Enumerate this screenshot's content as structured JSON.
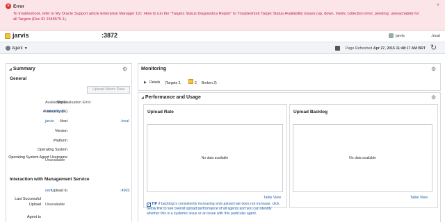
{
  "error": {
    "title": "Error",
    "message": "To troubleshoot, refer to My Oracle Support article Enterprise Manager 12c: How to run the \"Targets Status Diagnostics Report\" to Troubleshoot Target Status Availability Issues (up, down, metric collection error, pending, unreachable) for all Targets (Doc ID 1546575.1)."
  },
  "target": {
    "name": "jarvis",
    "port": ":3872",
    "user": "jarvis",
    "domain": ".local"
  },
  "toolbar": {
    "agent_menu": "Agent",
    "refreshed_label": "Page Refreshed",
    "refreshed_value": "Apr 27, 2015 11:48:17 AM BRT"
  },
  "summary": {
    "title": "Summary",
    "general_title": "General",
    "upload_button": "Upload Metric Data",
    "rows": [
      {
        "label": "Status",
        "value": "Availability Evaluation Error"
      },
      {
        "label": "Availability (%)",
        "value": "Unavailable"
      },
      {
        "label": "Host",
        "value": "jarvis",
        "extra": ".local"
      },
      {
        "label": "Version",
        "value": ""
      },
      {
        "label": "Platform",
        "value": ""
      },
      {
        "label": "Operating System",
        "value": ""
      },
      {
        "label": "Operating System Agent Username",
        "value": "Unavailable"
      }
    ],
    "interaction_title": "Interaction with Management Service",
    "interaction_rows": [
      {
        "label": "Upload to",
        "value": "oem",
        "extra": ":4903"
      },
      {
        "label": "Last Successful Upload",
        "value": "Unavailable"
      },
      {
        "label": "Agent to",
        "value": ""
      }
    ]
  },
  "monitoring": {
    "title": "Monitoring",
    "details_label": "Details",
    "targets_text": "(Targets 2,",
    "targets_count": "2,",
    "broken_text": "Broken 2)"
  },
  "performance": {
    "title": "Performance and Usage",
    "upload_rate_title": "Upload Rate",
    "upload_backlog_title": "Upload Backlog",
    "no_data": "No data available",
    "table_view": "Table View",
    "tip_label": "TIP",
    "tip_text": "If backlog is consistently increasing and upload rate does not increase, click below link to see overall upload performance of all agents and you can identify whether this is a systemic issue or an issue with this particular agent."
  }
}
